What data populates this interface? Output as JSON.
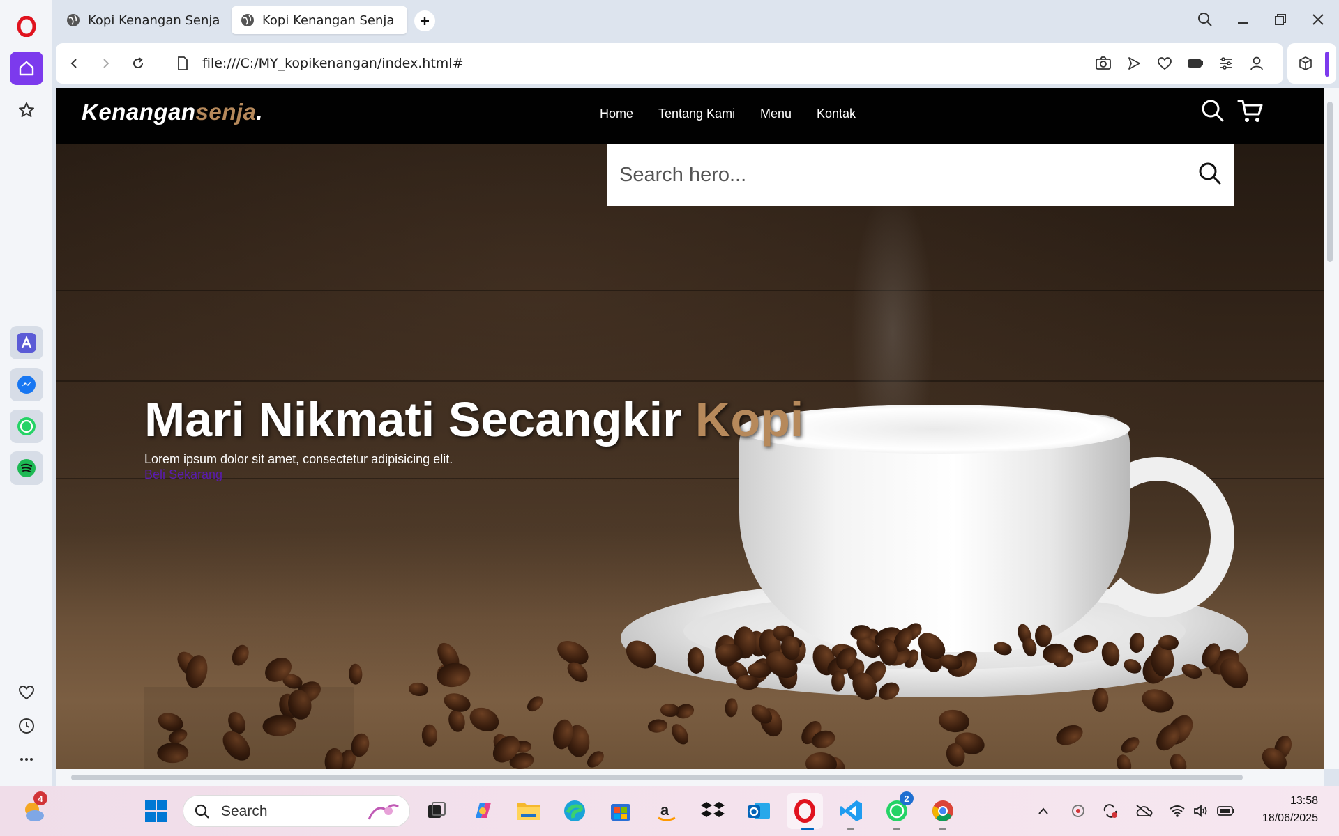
{
  "browser": {
    "tabs": [
      {
        "label": "Kopi Kenangan Senja",
        "active": false
      },
      {
        "label": "Kopi Kenangan Senja",
        "active": true
      }
    ],
    "url": "file:///C:/MY_kopikenangan/index.html#",
    "accent_color": "#7c3aed"
  },
  "site": {
    "logo": {
      "main": "Kenangan",
      "accent": "senja",
      "dot": "."
    },
    "nav": [
      "Home",
      "Tentang Kami",
      "Menu",
      "Kontak"
    ],
    "search": {
      "placeholder": "Search hero..."
    },
    "hero": {
      "title_main": "Mari Nikmati Secangkir ",
      "title_accent": "Kopi",
      "description": "Lorem ipsum dolor sit amet, consectetur adipisicing elit.",
      "cta": "Beli Sekarang"
    },
    "accent_color": "#b6895b"
  },
  "taskbar": {
    "search_label": "Search",
    "weather_badge": "4",
    "whatsapp_badge": "2",
    "time": "13:58",
    "date": "18/06/2025"
  }
}
